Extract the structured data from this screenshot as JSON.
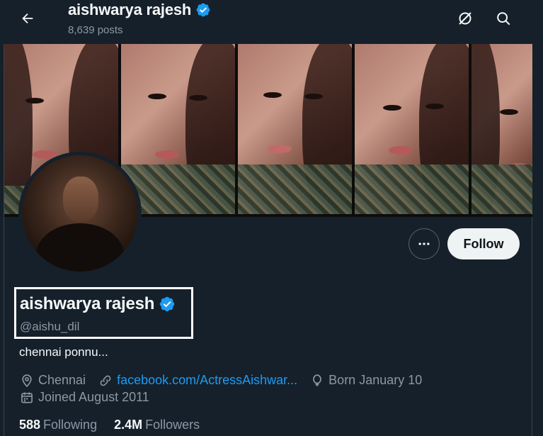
{
  "header": {
    "title": "aishwarya rajesh",
    "posts_count": "8,639 posts"
  },
  "profile": {
    "display_name": "aishwarya rajesh",
    "handle": "@aishu_dil",
    "bio": "chennai ponnu...",
    "location": "Chennai",
    "website": "facebook.com/ActressAishwar...",
    "birthday": "Born January 10",
    "joined": "Joined August 2011"
  },
  "actions": {
    "follow_label": "Follow"
  },
  "stats": {
    "following_count": "588",
    "following_label": "Following",
    "followers_count": "2.4M",
    "followers_label": "Followers"
  },
  "icons": {
    "back": "arrow-left-icon",
    "grok": "grok-icon",
    "search": "search-icon",
    "more": "more-horizontal-icon",
    "verified": "verified-badge-icon",
    "location": "location-pin-icon",
    "link": "link-icon",
    "birthday": "balloon-icon",
    "calendar": "calendar-icon"
  },
  "colors": {
    "background": "#15202b",
    "accent": "#1d9bf0",
    "secondary_text": "#8b98a5",
    "follow_button_bg": "#eff3f4"
  }
}
